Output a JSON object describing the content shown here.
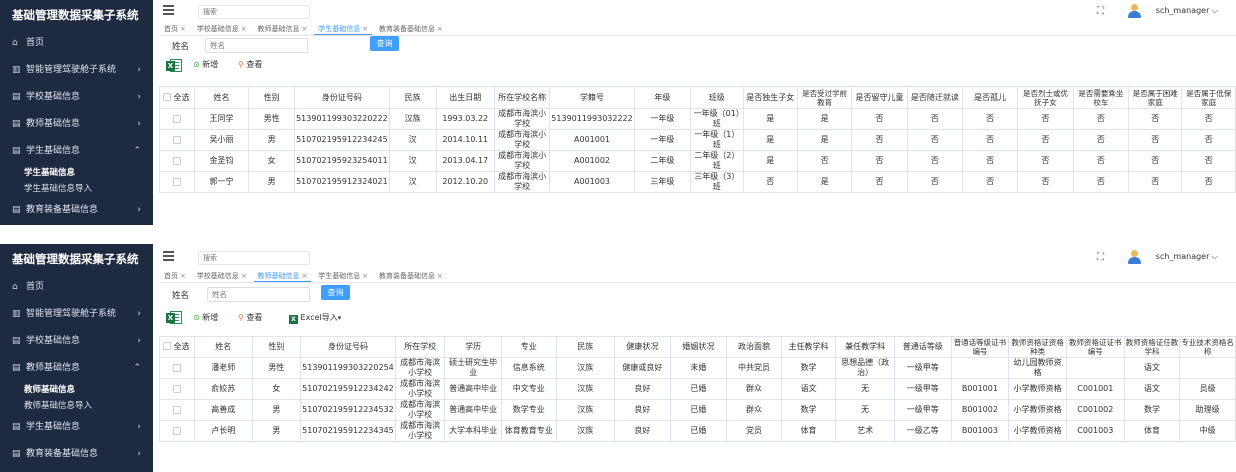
{
  "panels": [
    {
      "app_title": "基础管理数据采集子系统",
      "menu": [
        {
          "icon": "home-icon",
          "label": "首页"
        },
        {
          "icon": "chart-icon",
          "label": "智能管理驾驶舱子系统",
          "arrow": "›"
        },
        {
          "icon": "doc-icon",
          "label": "学校基础信息",
          "arrow": "›"
        },
        {
          "icon": "doc-icon",
          "label": "教师基础信息",
          "arrow": "›"
        },
        {
          "icon": "doc-icon",
          "label": "学生基础信息",
          "arrow": "⌃"
        },
        {
          "icon": "doc-icon",
          "label": "教育装备基础信息",
          "arrow": "›"
        }
      ],
      "submenu": [
        "学生基础信息",
        "学生基础信息导入"
      ],
      "search_placeholder": "搜索",
      "user": "sch_manager ⌵",
      "tabs": [
        "首页",
        "学校基础信息",
        "教师基础信息",
        "学生基础信息",
        "教育装备基础信息"
      ],
      "active_tab": 3,
      "filter_label": "姓名",
      "filter_placeholder": "姓名",
      "query_label": "查询",
      "add_label": "新增",
      "view_label": "查看",
      "select_all": "全选",
      "columns": [
        "姓名",
        "性别",
        "身份证号码",
        "民族",
        "出生日期",
        "所在学校名称",
        "学籍号",
        "年级",
        "班级",
        "是否独生子女",
        "是否受过学前教育",
        "是否留守儿童",
        "是否随迁就读",
        "是否孤儿",
        "是否烈士或优抚子女",
        "是否需要乘坐校车",
        "是否属于困难家庭",
        "是否属于低保家庭"
      ],
      "rows": [
        [
          "王同学",
          "男性",
          "513901199303220222",
          "汉族",
          "1993.03.22",
          "成都市海滨小学校",
          "5139011993032222",
          "一年级",
          "一年级（01）班",
          "是",
          "是",
          "否",
          "否",
          "否",
          "否",
          "否",
          "否",
          "否"
        ],
        [
          "吴小丽",
          "男",
          "510702195912234245",
          "汉",
          "2014.10.11",
          "成都市海滨小学校",
          "A001001",
          "一年级",
          "一年级（1）班",
          "是",
          "是",
          "否",
          "否",
          "否",
          "否",
          "否",
          "否",
          "否"
        ],
        [
          "金圣钧",
          "女",
          "510702195923254011",
          "汉",
          "2013.04.17",
          "成都市海滨小学校",
          "A001002",
          "二年级",
          "二年级（2）班",
          "是",
          "否",
          "否",
          "否",
          "否",
          "否",
          "否",
          "否",
          "否"
        ],
        [
          "郭一宁",
          "男",
          "510702195912324021",
          "汉",
          "2012.10.20",
          "成都市海滨小学校",
          "A001003",
          "三年级",
          "三年级（3）班",
          "否",
          "是",
          "否",
          "否",
          "否",
          "否",
          "否",
          "否",
          "否"
        ]
      ]
    },
    {
      "app_title": "基础管理数据采集子系统",
      "menu": [
        {
          "icon": "home-icon",
          "label": "首页"
        },
        {
          "icon": "chart-icon",
          "label": "智能管理驾驶舱子系统",
          "arrow": "›"
        },
        {
          "icon": "doc-icon",
          "label": "学校基础信息",
          "arrow": "›"
        },
        {
          "icon": "doc-icon",
          "label": "教师基础信息",
          "arrow": "⌃"
        },
        {
          "icon": "doc-icon",
          "label": "学生基础信息",
          "arrow": "›"
        },
        {
          "icon": "doc-icon",
          "label": "教育装备基础信息",
          "arrow": "›"
        }
      ],
      "submenu": [
        "教师基础信息",
        "教师基础信息导入"
      ],
      "search_placeholder": "搜索",
      "user": "sch_manager ⌵",
      "tabs": [
        "首页",
        "学校基础信息",
        "教师基础信息",
        "学生基础信息",
        "教育装备基础信息"
      ],
      "active_tab": 2,
      "filter_label": "姓名",
      "filter_placeholder": "姓名",
      "query_label": "查询",
      "add_label": "新增",
      "view_label": "查看",
      "import_label": "Excel导入",
      "select_all": "全选",
      "columns": [
        "姓名",
        "性别",
        "身份证号码",
        "所在学校",
        "学历",
        "专业",
        "民族",
        "健康状况",
        "婚姻状况",
        "政治面貌",
        "主任教学科",
        "兼任教学科",
        "普通话等级",
        "普通话等级证书编号",
        "教师资格证资格种类",
        "教师资格证证书编号",
        "教师资格证任教学科",
        "专业技术资格名称"
      ],
      "rows": [
        [
          "潘老师",
          "男性",
          "513901199303220254",
          "成都市海滨小学校",
          "硕士研究生毕业",
          "信息系统",
          "汉族",
          "健康或良好",
          "未婚",
          "中共党员",
          "数学",
          "思想品德（政治）",
          "一级甲等",
          "",
          "幼儿园教师资格",
          "",
          "语文",
          ""
        ],
        [
          "俞姣苏",
          "女",
          "510702195912234242",
          "成都市海滨小学校",
          "普通高中毕业",
          "中文专业",
          "汉族",
          "良好",
          "已婚",
          "群众",
          "语文",
          "无",
          "一级甲等",
          "B001001",
          "小学教师资格",
          "C001001",
          "语文",
          "员级"
        ],
        [
          "高善成",
          "男",
          "510702195912234532",
          "成都市海滨小学校",
          "普通高中毕业",
          "数学专业",
          "汉族",
          "良好",
          "已婚",
          "群众",
          "数学",
          "无",
          "一级甲等",
          "B001002",
          "小学教师资格",
          "C001002",
          "数学",
          "助理级"
        ],
        [
          "卢长明",
          "男",
          "510702195912234345",
          "成都市海滨小学校",
          "大学本科毕业",
          "体育教育专业",
          "汉族",
          "良好",
          "已婚",
          "党员",
          "体育",
          "艺术",
          "一级乙等",
          "B001003",
          "小学教师资格",
          "C001003",
          "体育",
          "中级"
        ]
      ]
    }
  ]
}
